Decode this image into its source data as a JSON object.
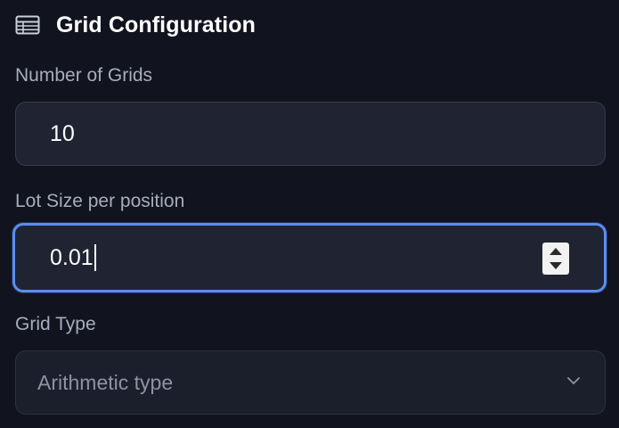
{
  "header": {
    "title": "Grid Configuration",
    "icon": "table-icon"
  },
  "fields": {
    "number_of_grids": {
      "label": "Number of Grids",
      "value": "10"
    },
    "lot_size": {
      "label": "Lot Size per position",
      "value": "0.01"
    },
    "grid_type": {
      "label": "Grid Type",
      "selected": "Arithmetic type"
    }
  },
  "colors": {
    "background": "#11131f",
    "input_bg": "#202432",
    "focus_border": "#5b8dee",
    "label": "#a6adbb"
  }
}
